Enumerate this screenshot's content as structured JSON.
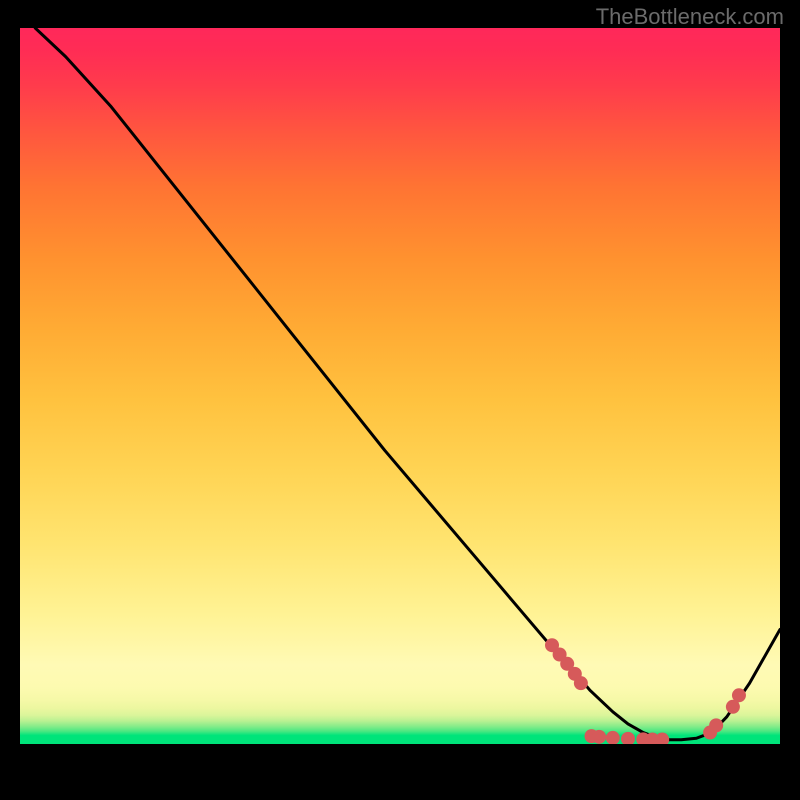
{
  "watermark": "TheBottleneck.com",
  "colors": {
    "curve": "#000000",
    "dots": "#d65a5a",
    "gradient_top": "#ff285a",
    "gradient_mid": "#ffe470",
    "gradient_bottom": "#00e47a",
    "background": "#000000"
  },
  "chart_data": {
    "type": "line",
    "title": "",
    "xlabel": "",
    "ylabel": "",
    "xlim": [
      0,
      100
    ],
    "ylim": [
      0,
      100
    ],
    "grid": false,
    "series": [
      {
        "name": "bottleneck-curve",
        "x": [
          2,
          6,
          12,
          18,
          24,
          30,
          36,
          42,
          48,
          54,
          60,
          66,
          70,
          73,
          75,
          78,
          80,
          82,
          83.5,
          85,
          87,
          89,
          91,
          93,
          96,
          100
        ],
        "y": [
          100,
          96,
          89,
          81,
          73,
          65,
          57,
          49,
          41,
          33.5,
          26,
          18.5,
          13.5,
          10,
          7.5,
          4.5,
          2.8,
          1.6,
          1.0,
          0.6,
          0.6,
          0.8,
          1.6,
          3.8,
          8.5,
          16
        ]
      }
    ],
    "markers": {
      "name": "highlight-dots",
      "points": [
        {
          "x": 70,
          "y": 13.8
        },
        {
          "x": 71,
          "y": 12.5
        },
        {
          "x": 72,
          "y": 11.2
        },
        {
          "x": 73,
          "y": 9.8
        },
        {
          "x": 73.8,
          "y": 8.5
        },
        {
          "x": 75.2,
          "y": 1.1
        },
        {
          "x": 76.2,
          "y": 1.0
        },
        {
          "x": 78,
          "y": 0.85
        },
        {
          "x": 80,
          "y": 0.72
        },
        {
          "x": 82,
          "y": 0.65
        },
        {
          "x": 83.2,
          "y": 0.62
        },
        {
          "x": 84.5,
          "y": 0.62
        },
        {
          "x": 90.8,
          "y": 1.6
        },
        {
          "x": 91.6,
          "y": 2.6
        },
        {
          "x": 93.8,
          "y": 5.2
        },
        {
          "x": 94.6,
          "y": 6.8
        }
      ]
    }
  }
}
